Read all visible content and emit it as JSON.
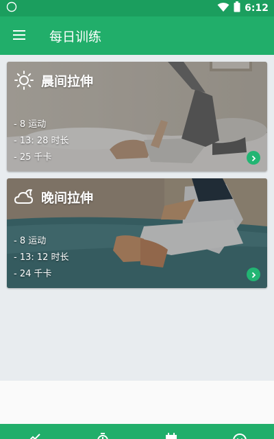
{
  "status_bar": {
    "time": "6:12",
    "icons": [
      "sync-indicator-icon",
      "wifi-icon",
      "battery-icon"
    ]
  },
  "app_bar": {
    "menu_icon": "hamburger-menu-icon",
    "title": "每日训练"
  },
  "workouts": [
    {
      "title": "晨间拉伸",
      "icon": "sun-icon",
      "stats": [
        "- 8 运动",
        "- 13: 28 时长",
        "- 25 千卡"
      ]
    },
    {
      "title": "晚间拉伸",
      "icon": "moon-cloud-icon",
      "stats": [
        "- 8 运动",
        "- 13: 12 时长",
        "- 24 千卡"
      ]
    }
  ],
  "bottom_nav": {
    "items": [
      "report-trend-icon",
      "timer-icon",
      "calendar-icon",
      "profile-smile-icon"
    ]
  },
  "colors": {
    "status_bar": "#1b9e5e",
    "app_bar": "#21ae6a",
    "background": "#e8ecef",
    "accent_button": "#22b573"
  }
}
